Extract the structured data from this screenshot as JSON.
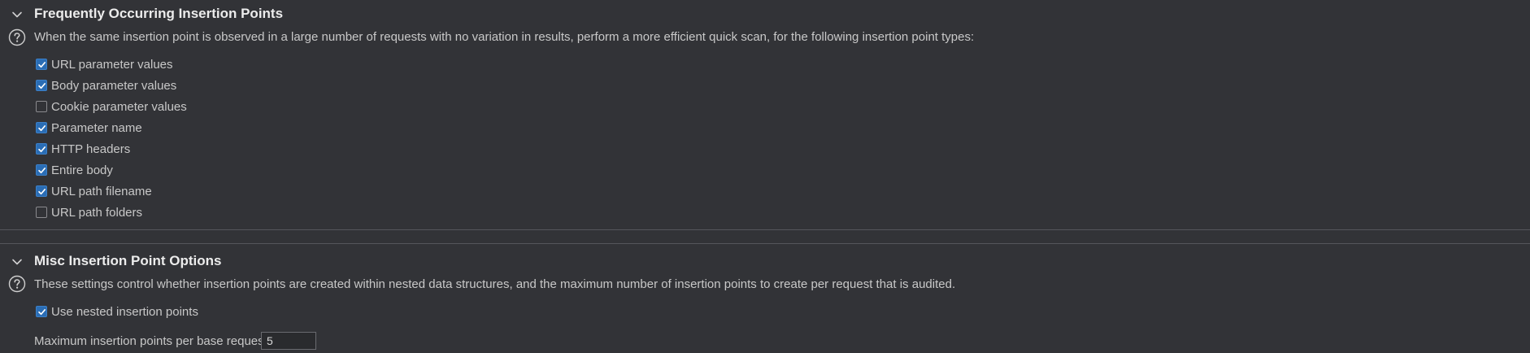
{
  "section1": {
    "title": "Frequently Occurring Insertion Points",
    "description": "When the same insertion point is observed in a large number of requests with no variation in results, perform a more efficient quick scan, for the following insertion point types:",
    "options": [
      {
        "label": "URL parameter values",
        "checked": true
      },
      {
        "label": "Body parameter values",
        "checked": true
      },
      {
        "label": "Cookie parameter values",
        "checked": false
      },
      {
        "label": "Parameter name",
        "checked": true
      },
      {
        "label": "HTTP headers",
        "checked": true
      },
      {
        "label": "Entire body",
        "checked": true
      },
      {
        "label": "URL path filename",
        "checked": true
      },
      {
        "label": "URL path folders",
        "checked": false
      }
    ]
  },
  "section2": {
    "title": "Misc Insertion Point Options",
    "description": "These settings control whether insertion points are created within nested data structures, and the maximum number of insertion points to create per request that is audited.",
    "nested": {
      "label": "Use nested insertion points",
      "checked": true
    },
    "max_label": "Maximum insertion points per base request:",
    "max_value": "5"
  },
  "colors": {
    "background": "#323337",
    "checkbox_checked": "#2a6db5",
    "divider": "#55565b"
  },
  "icons": {
    "collapse": "chevron-down-icon",
    "help": "help-circle-icon",
    "check": "checkmark-icon"
  }
}
